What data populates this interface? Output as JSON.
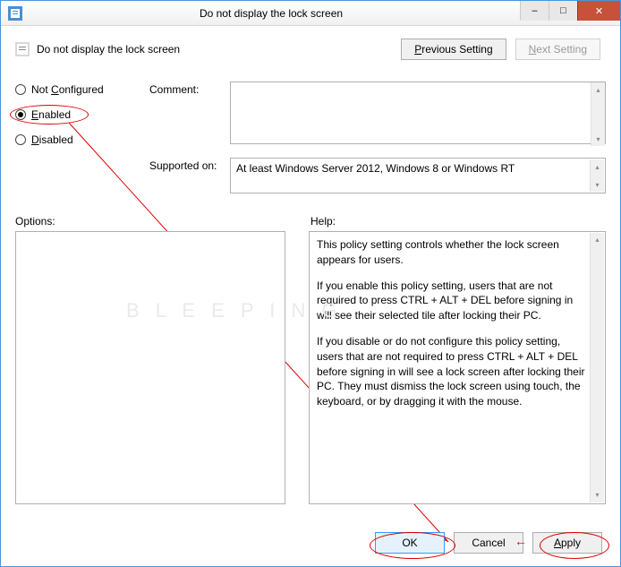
{
  "window": {
    "title": "Do not display the lock screen",
    "subtitle": "Do not display the lock screen"
  },
  "nav": {
    "prev_label": "Previous Setting",
    "next_label": "Next Setting"
  },
  "radios": {
    "not_configured": "Not Configured",
    "enabled": "Enabled",
    "disabled": "Disabled",
    "selected": "enabled"
  },
  "fields": {
    "comment_label": "Comment:",
    "comment_value": "",
    "supported_label": "Supported on:",
    "supported_value": "At least Windows Server 2012, Windows 8 or Windows RT"
  },
  "labels": {
    "options": "Options:",
    "help": "Help:"
  },
  "help": {
    "p1": "This policy setting controls whether the lock screen appears for users.",
    "p2": "If you enable this policy setting, users that are not required to press CTRL + ALT + DEL before signing in will see their selected tile after  locking their PC.",
    "p3": "If you disable or do not configure this policy setting, users that are not required to press CTRL + ALT + DEL before signing in will see a lock screen after locking their PC. They must dismiss the lock screen using touch, the keyboard, or by dragging it with the mouse."
  },
  "buttons": {
    "ok": "OK",
    "cancel": "Cancel",
    "apply": "Apply"
  },
  "colors": {
    "accent": "#3399ff",
    "close": "#c9503a",
    "annot": "#d00000"
  }
}
